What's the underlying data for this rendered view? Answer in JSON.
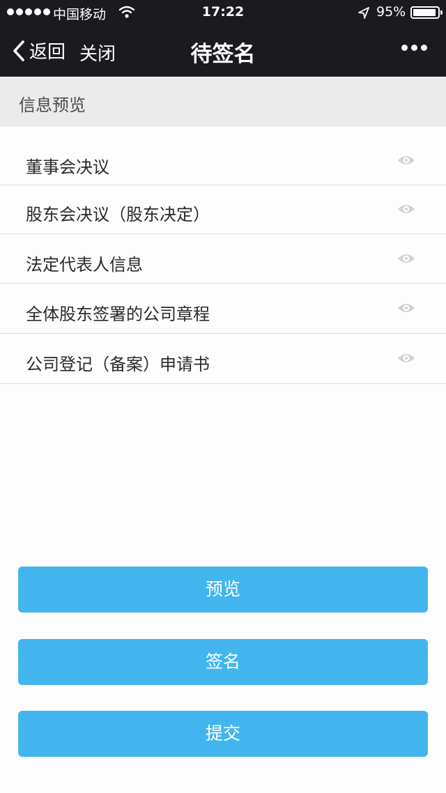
{
  "status_bar": {
    "carrier": "中国移动",
    "time": "17:22",
    "battery": "95%",
    "battery_level": 0.95
  },
  "nav": {
    "back_label": "返回",
    "close_label": "关闭",
    "title": "待签名",
    "more_icon": "more-dots-icon"
  },
  "section": {
    "title": "信息预览"
  },
  "documents": [
    {
      "label": "董事会决议",
      "icon": "eye-icon"
    },
    {
      "label": "股东会决议（股东决定）",
      "icon": "eye-icon"
    },
    {
      "label": "法定代表人信息",
      "icon": "eye-icon"
    },
    {
      "label": "全体股东签署的公司章程",
      "icon": "eye-icon"
    },
    {
      "label": "公司登记（备案）申请书",
      "icon": "eye-icon"
    }
  ],
  "actions": {
    "preview": "预览",
    "sign": "签名",
    "submit": "提交"
  },
  "colors": {
    "nav_background": "#1b1a1f",
    "section_background": "#ebebeb",
    "button": "#43b5ee",
    "eye_icon": "#d2d2d2"
  }
}
